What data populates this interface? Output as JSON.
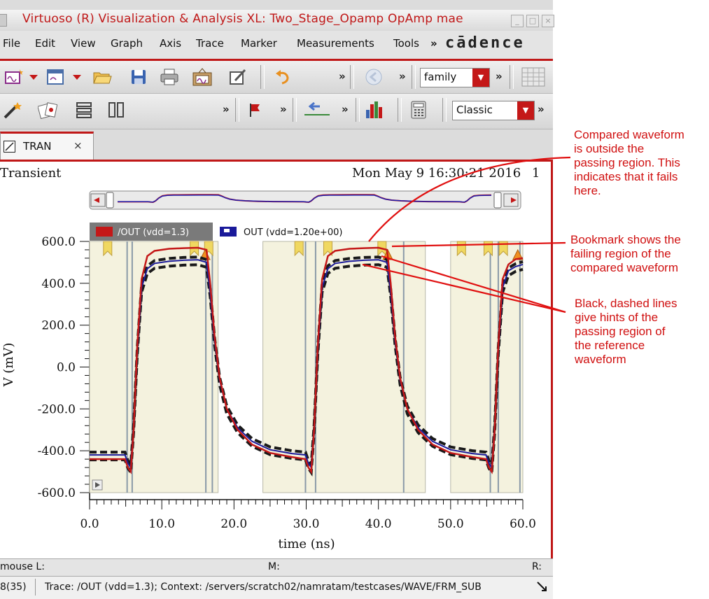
{
  "window": {
    "title": "Virtuoso (R) Visualization & Analysis XL: Two_Stage_Opamp OpAmp mae"
  },
  "menu": {
    "items": [
      "File",
      "Edit",
      "View",
      "Graph",
      "Axis",
      "Trace",
      "Marker",
      "Measurements",
      "Tools"
    ],
    "more": "»",
    "brand": "cādence"
  },
  "toolbar1": {
    "combo_value": "family",
    "more": "»"
  },
  "toolbar2": {
    "combo_value": "Classic",
    "more": "»"
  },
  "tab": {
    "label": "TRAN",
    "close": "×"
  },
  "plot": {
    "analysis": "Transient",
    "timestamp": "Mon May 9 16:30:21 2016",
    "page": "1",
    "legend": [
      {
        "label": "/OUT (vdd=1.3)",
        "color": "#c41818"
      },
      {
        "label": "OUT (vdd=1.20e+00)",
        "color": "#1a1a9a"
      }
    ]
  },
  "chart_data": {
    "type": "line",
    "xlabel": "time (ns)",
    "ylabel": "V (mV)",
    "xlim": [
      0,
      60
    ],
    "ylim": [
      -600,
      600
    ],
    "x_ticks": [
      "0.0",
      "10.0",
      "20.0",
      "30.0",
      "40.0",
      "50.0",
      "60.0"
    ],
    "y_ticks": [
      "600.0",
      "400.0",
      "200.0",
      "0.0",
      "-200.0",
      "-400.0",
      "-600.0"
    ],
    "series": [
      {
        "name": "/OUT (vdd=1.3)",
        "color": "#c41818",
        "x": [
          0,
          4.9,
          5.3,
          5.7,
          6.1,
          6.6,
          7.2,
          8.0,
          9.0,
          11.0,
          13.0,
          15.0,
          16.2,
          16.7,
          17.3,
          18.0,
          19.0,
          20.5,
          22.5,
          25.0,
          28.0,
          29.9,
          30.3,
          30.7,
          31.1,
          31.6,
          32.2,
          33.0,
          34.0,
          36.0,
          38.0,
          40.0,
          41.2,
          41.7,
          42.3,
          43.0,
          44.0,
          45.5,
          47.5,
          50.0,
          53.0,
          54.9,
          55.3,
          55.7,
          56.1,
          56.6,
          57.2,
          58.0,
          59.0,
          60.0
        ],
        "y": [
          -440,
          -440,
          -480,
          -500,
          -300,
          100,
          420,
          530,
          555,
          565,
          568,
          570,
          560,
          400,
          150,
          -50,
          -200,
          -300,
          -370,
          -410,
          -430,
          -440,
          -480,
          -500,
          -300,
          100,
          420,
          530,
          555,
          565,
          568,
          570,
          560,
          400,
          150,
          -50,
          -200,
          -300,
          -370,
          -410,
          -430,
          -440,
          -480,
          -500,
          -300,
          100,
          420,
          490,
          515,
          520
        ]
      },
      {
        "name": "OUT (vdd=1.20e+00)",
        "color": "#1a1a9a",
        "x": [
          0,
          4.9,
          5.3,
          5.7,
          6.1,
          6.6,
          7.2,
          8.0,
          9.0,
          11.0,
          13.0,
          15.0,
          16.2,
          16.7,
          17.3,
          18.0,
          19.0,
          20.5,
          22.5,
          25.0,
          28.0,
          29.9,
          30.3,
          30.7,
          31.1,
          31.6,
          32.2,
          33.0,
          34.0,
          36.0,
          38.0,
          40.0,
          41.2,
          41.7,
          42.3,
          43.0,
          44.0,
          45.5,
          47.5,
          50.0,
          53.0,
          54.9,
          55.3,
          55.7,
          56.1,
          56.6,
          57.2,
          58.0,
          59.0,
          60.0
        ],
        "y": [
          -420,
          -420,
          -460,
          -480,
          -290,
          80,
          380,
          470,
          495,
          505,
          510,
          512,
          500,
          360,
          130,
          -60,
          -200,
          -290,
          -355,
          -395,
          -413,
          -420,
          -460,
          -480,
          -290,
          80,
          380,
          470,
          495,
          505,
          510,
          512,
          500,
          360,
          130,
          -60,
          -200,
          -290,
          -355,
          -395,
          -413,
          -420,
          -460,
          -480,
          -290,
          80,
          380,
          460,
          480,
          490
        ]
      }
    ],
    "grid": false,
    "legend_position": "top-left"
  },
  "annotations": [
    {
      "lines": [
        "Compared waveform",
        "is outside the",
        "passing region. This",
        "indicates that it fails",
        "here."
      ]
    },
    {
      "lines": [
        "Bookmark shows the",
        "failing region of the",
        "compared waveform"
      ]
    },
    {
      "lines": [
        "Black, dashed lines",
        "give hints of the",
        "passing region of",
        "the reference",
        "waveform"
      ]
    }
  ],
  "status": {
    "mouse_l": "mouse L:",
    "m": "M:",
    "r": "R:",
    "counter": "8(35)",
    "message": "Trace: /OUT (vdd=1.3); Context: /servers/scratch02/namratam/testcases/WAVE/FRM_SUB"
  }
}
